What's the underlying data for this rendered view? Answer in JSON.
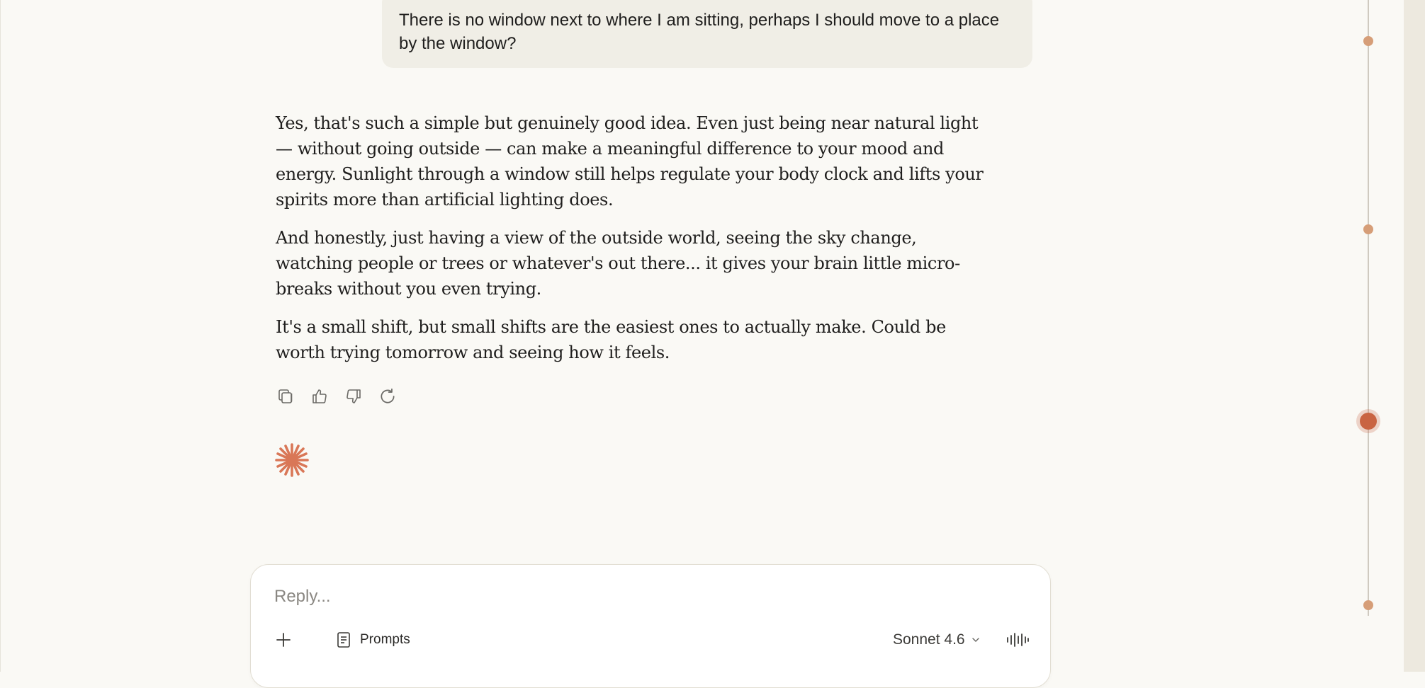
{
  "conversation": {
    "user_message": "There is no window next to where I am sitting, perhaps I should move to a place by the window?",
    "assistant_paragraphs": [
      "Yes, that's such a simple but genuinely good idea. Even just being near natural light — without going outside — can make a meaningful difference to your mood and energy. Sunlight through a window still helps regulate your body clock and lifts your spirits more than artificial lighting does.",
      "And honestly, just having a view of the outside world, seeing the sky change, watching people or trees or whatever's out there... it gives your brain little micro-breaks without you even trying.",
      "It's a small shift, but small shifts are the easiest ones to actually make. Could be worth trying tomorrow and seeing how it feels."
    ]
  },
  "actions": {
    "icons": [
      "copy-icon",
      "thumbs-up-icon",
      "thumbs-down-icon",
      "retry-icon"
    ]
  },
  "composer": {
    "placeholder": "Reply...",
    "prompts_label": "Prompts",
    "model_label": "Sonnet 4.6"
  },
  "timeline": {
    "markers": 4,
    "active_marker": 3
  },
  "colors": {
    "background": "#faf9f5",
    "user_bubble": "#f0eee6",
    "accent": "#c96442",
    "timeline_dot": "#d69e78",
    "right_strip": "#ede9df"
  }
}
